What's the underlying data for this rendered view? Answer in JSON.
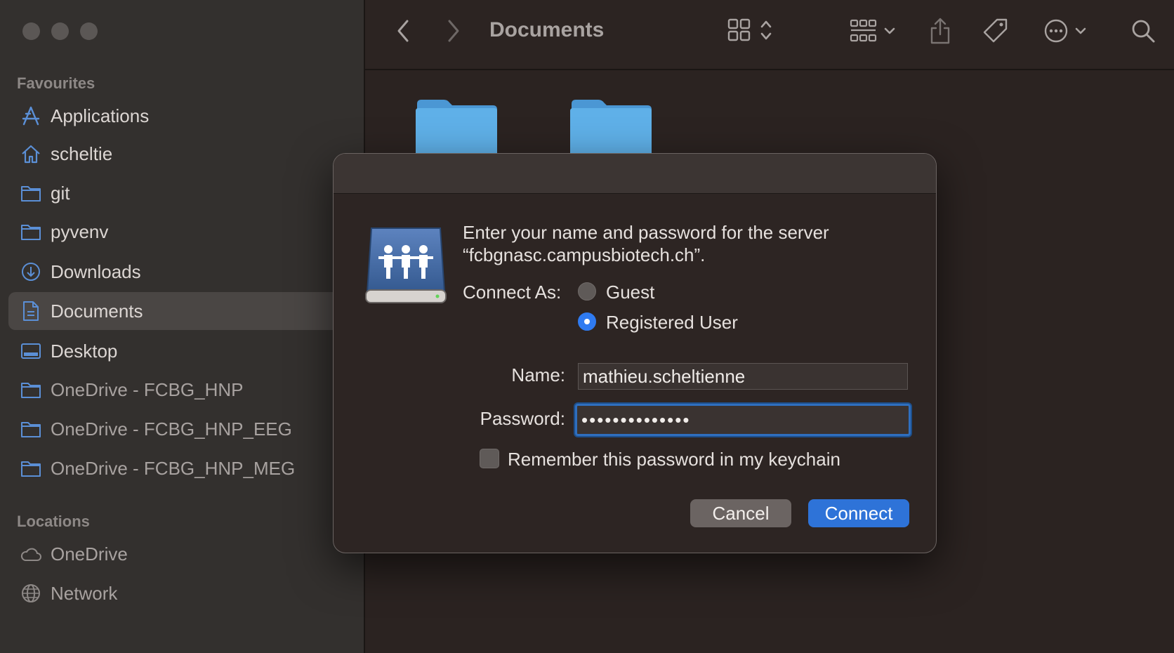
{
  "window": {
    "title": "Documents",
    "colors": {
      "accent": "#2e73d8",
      "folder": "#5fb0e8",
      "sidebar_icon": "#5b8fd6"
    }
  },
  "toolbar": {
    "back_icon": "chevron-left-icon",
    "forward_icon": "chevron-right-icon",
    "view_icon": "grid-view-icon",
    "group_icon": "group-by-icon",
    "share_icon": "share-icon",
    "tag_icon": "tag-icon",
    "more_icon": "ellipsis-circle-icon",
    "search_icon": "search-icon"
  },
  "sidebar": {
    "favourites_title": "Favourites",
    "favourites": [
      {
        "label": "Applications",
        "icon": "applications-icon"
      },
      {
        "label": "scheltie",
        "icon": "home-icon"
      },
      {
        "label": "git",
        "icon": "folder-icon"
      },
      {
        "label": "pyvenv",
        "icon": "folder-icon"
      },
      {
        "label": "Downloads",
        "icon": "download-icon"
      },
      {
        "label": "Documents",
        "icon": "document-icon",
        "selected": true
      },
      {
        "label": "Desktop",
        "icon": "desktop-icon"
      },
      {
        "label": "OneDrive - FCBG_HNP",
        "icon": "folder-icon"
      },
      {
        "label": "OneDrive - FCBG_HNP_EEG",
        "icon": "folder-icon"
      },
      {
        "label": "OneDrive - FCBG_HNP_MEG",
        "icon": "folder-icon"
      }
    ],
    "locations_title": "Locations",
    "locations": [
      {
        "label": "OneDrive",
        "icon": "cloud-icon"
      },
      {
        "label": "Network",
        "icon": "globe-icon"
      }
    ]
  },
  "dialog": {
    "icon": "shared-server-icon",
    "message_line1": "Enter your name and password for the server",
    "message_line2": "“fcbgnasc.campusbiotech.ch”.",
    "connect_as_label": "Connect As:",
    "options": [
      {
        "label": "Guest",
        "selected": false
      },
      {
        "label": "Registered User",
        "selected": true
      }
    ],
    "name_label": "Name:",
    "name_value": "mathieu.scheltienne",
    "password_label": "Password:",
    "password_value": "••••••••••••••",
    "remember_label": "Remember this password in my keychain",
    "remember_checked": false,
    "cancel_label": "Cancel",
    "connect_label": "Connect"
  }
}
